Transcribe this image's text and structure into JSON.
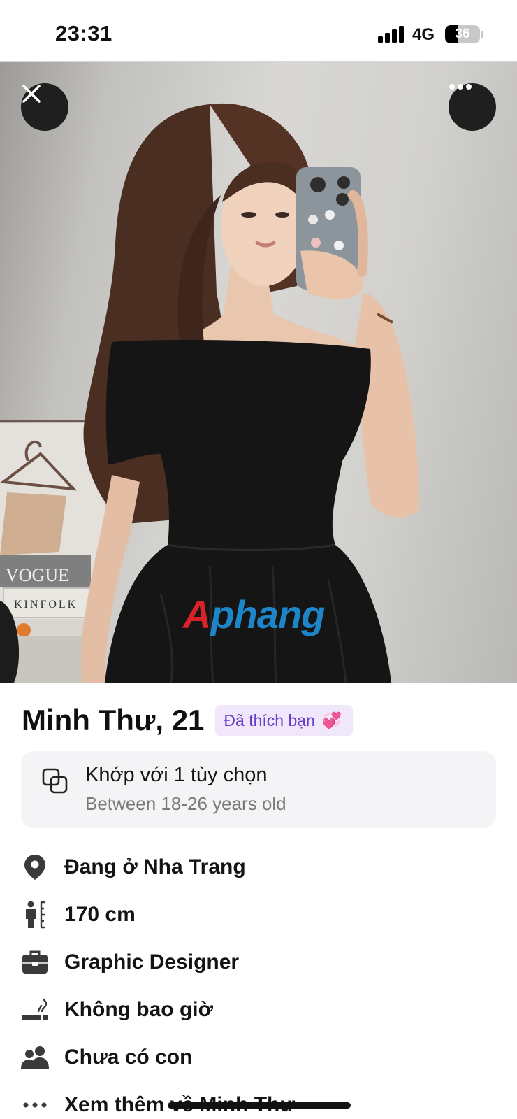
{
  "status_bar": {
    "time": "23:31",
    "network": "4G",
    "battery": "36",
    "battery_level": 0.36
  },
  "photo": {
    "watermark_brand_first": "A",
    "watermark_brand_rest": "phang",
    "close_icon": "close-icon",
    "more_icon": "more-icon",
    "decor_text": [
      "VOGUE",
      "KINFOLK"
    ]
  },
  "profile": {
    "name_age": "Minh Thư, 21",
    "liked_badge": "Đã thích bạn",
    "liked_emoji": "💞",
    "match_title": "Khớp với 1 tùy chọn",
    "match_subtitle": "Between 18-26 years old",
    "details": [
      {
        "icon": "location-pin-icon",
        "text": "Đang ở Nha Trang"
      },
      {
        "icon": "height-icon",
        "text": "170 cm"
      },
      {
        "icon": "briefcase-icon",
        "text": "Graphic Designer"
      },
      {
        "icon": "smoking-icon",
        "text": "Không bao giờ"
      },
      {
        "icon": "people-icon",
        "text": "Chưa có con"
      },
      {
        "icon": "more-dots-icon",
        "text": "Xem thêm về Minh Thư"
      }
    ]
  },
  "colors": {
    "badge_bg": "#f1e7fb",
    "badge_text": "#6a3cc9",
    "card_bg": "#f4f4f6",
    "watermark_red": "#d8232a",
    "watermark_blue": "#1c86c8"
  }
}
